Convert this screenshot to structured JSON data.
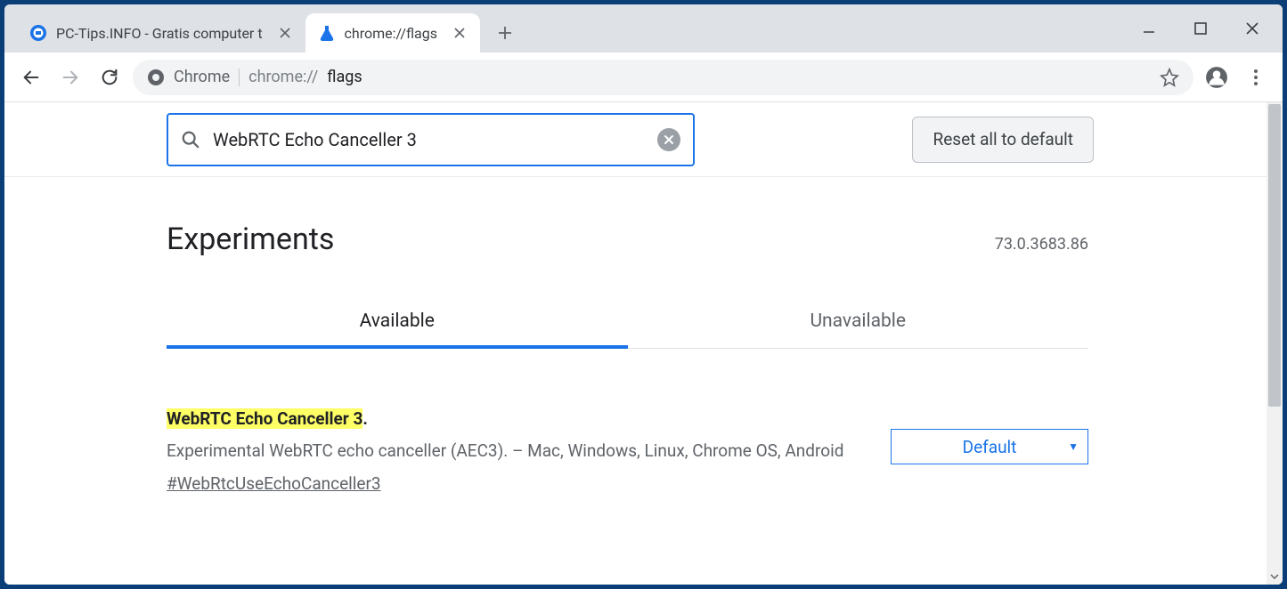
{
  "tabs": {
    "inactive_title": "PC-Tips.INFO - Gratis computer t",
    "active_title": "chrome://flags"
  },
  "omnibox": {
    "label": "Chrome",
    "url_prefix": "chrome://",
    "url_path": "flags"
  },
  "search": {
    "value": "WebRTC Echo Canceller 3",
    "reset_label": "Reset all to default"
  },
  "heading": "Experiments",
  "version": "73.0.3683.86",
  "tab_labels": {
    "available": "Available",
    "unavailable": "Unavailable"
  },
  "flag": {
    "title_hl": "WebRTC Echo Canceller 3",
    "title_tail": ".",
    "description": "Experimental WebRTC echo canceller (AEC3). – Mac, Windows, Linux, Chrome OS, Android",
    "link": "#WebRtcUseEchoCanceller3",
    "select_value": "Default"
  }
}
